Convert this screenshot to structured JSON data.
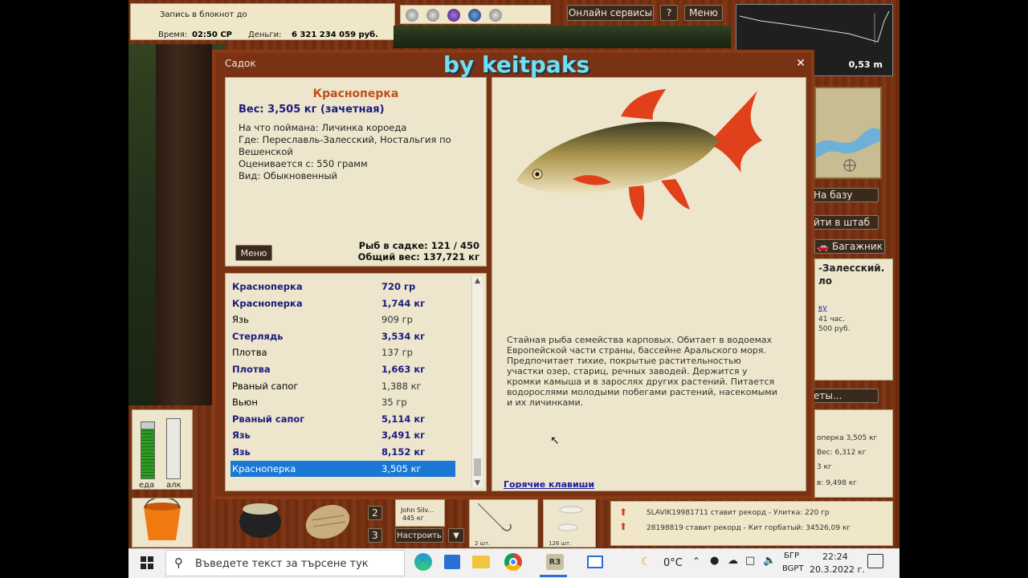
{
  "topbar": {
    "notebook_label": "Запись в блокнот до",
    "time_label": "Время:",
    "time_value": "02:50 СР",
    "money_label": "Деньги:",
    "money_value": "6 321 234 059 руб.",
    "online_services": "Онлайн сервисы",
    "help": "?",
    "menu": "Меню"
  },
  "depth": {
    "value": "0,53 m"
  },
  "watermark": "by keitpaks",
  "dialog": {
    "title": "Садок",
    "close": "✕",
    "fish_name": "Красноперка",
    "weight_line": "Вес: 3,505 кг (зачетная)",
    "caught_on": "На что поймана: Личинка короеда",
    "where": "Где: Переславль-Залесский, Ностальгия по Вешенской",
    "valued_from": "Оценивается с: 550 грамм",
    "kind": "Вид: Обыкновенный",
    "menu_button": "Меню",
    "fish_in_keepnet": "Рыб в садке: 121 / 450",
    "total_weight": "Общий вес: 137,721 кг",
    "description": "Стайная рыба семейства карповых. Обитает в водоемах Европейской части страны, бассейне Аральского моря. Предпочитает тихие, покрытые растительностью участки озер, стариц, речных заводей. Держится у кромки камыша и в зарослях других растений. Питается водорослями молодыми побегами растений, насекомыми и их личинками.",
    "hotkeys": "Горячие клавиши",
    "list": [
      {
        "name": "Красноперка",
        "weight": "720 гр",
        "bold": true
      },
      {
        "name": "Красноперка",
        "weight": "1,744 кг",
        "bold": true
      },
      {
        "name": "Язь",
        "weight": "909 гр",
        "bold": false
      },
      {
        "name": "Стерлядь",
        "weight": "3,534 кг",
        "bold": true
      },
      {
        "name": "Плотва",
        "weight": "137 гр",
        "bold": false
      },
      {
        "name": "Плотва",
        "weight": "1,663 кг",
        "bold": true
      },
      {
        "name": "Рваный сапог",
        "weight": "1,388 кг",
        "bold": false
      },
      {
        "name": "Вьюн",
        "weight": "35 гр",
        "bold": false
      },
      {
        "name": "Рваный сапог",
        "weight": "5,114 кг",
        "bold": true
      },
      {
        "name": "Язь",
        "weight": "3,491 кг",
        "bold": true
      },
      {
        "name": "Язь",
        "weight": "8,152 кг",
        "bold": true
      },
      {
        "name": "Красноперка",
        "weight": "3,505 кг",
        "bold": false,
        "selected": true
      }
    ]
  },
  "right_panel": {
    "to_base": "На базу",
    "to_hq": "йти в штаб",
    "trunk": "Багажник",
    "location_line1": "-Залесский.",
    "location_line2": "ло",
    "info1": "41 час.",
    "info2": "500 руб.",
    "link_stub": "ку",
    "records_btn": "еты...",
    "records": [
      "оперка 3,505 кг",
      "Вес: 6,312 кг",
      "3 кг",
      "в: 9,498 кг"
    ]
  },
  "feed": [
    "SLAVIK19981711 ставит рекорд - Улитка: 220 гр",
    "28198819 ставит рекорд - Кит горбатый: 34526,09 кг"
  ],
  "bottom": {
    "food_label": "еда",
    "alc_label": "алк",
    "slot2": "2",
    "slot3": "3",
    "player_name": "John Silv...",
    "player_weight": "445 кг",
    "settings": "Настроить",
    "dropdown": "▼",
    "item1_count": "2 шт.",
    "item2_count": "126 шт."
  },
  "taskbar": {
    "search_placeholder": "Въведете текст за търсене тук",
    "temperature": "0°C",
    "lang1": "БГР",
    "lang2": "BGPT",
    "time": "22:24",
    "date": "20.3.2022 г."
  },
  "colors": {
    "fish_name": "#c0501a",
    "bold_row": "#1b1b7e",
    "selected_row": "#1a78d4",
    "hotkeys_link": "#1b1b9e",
    "watermark": "#6fe0f0"
  }
}
